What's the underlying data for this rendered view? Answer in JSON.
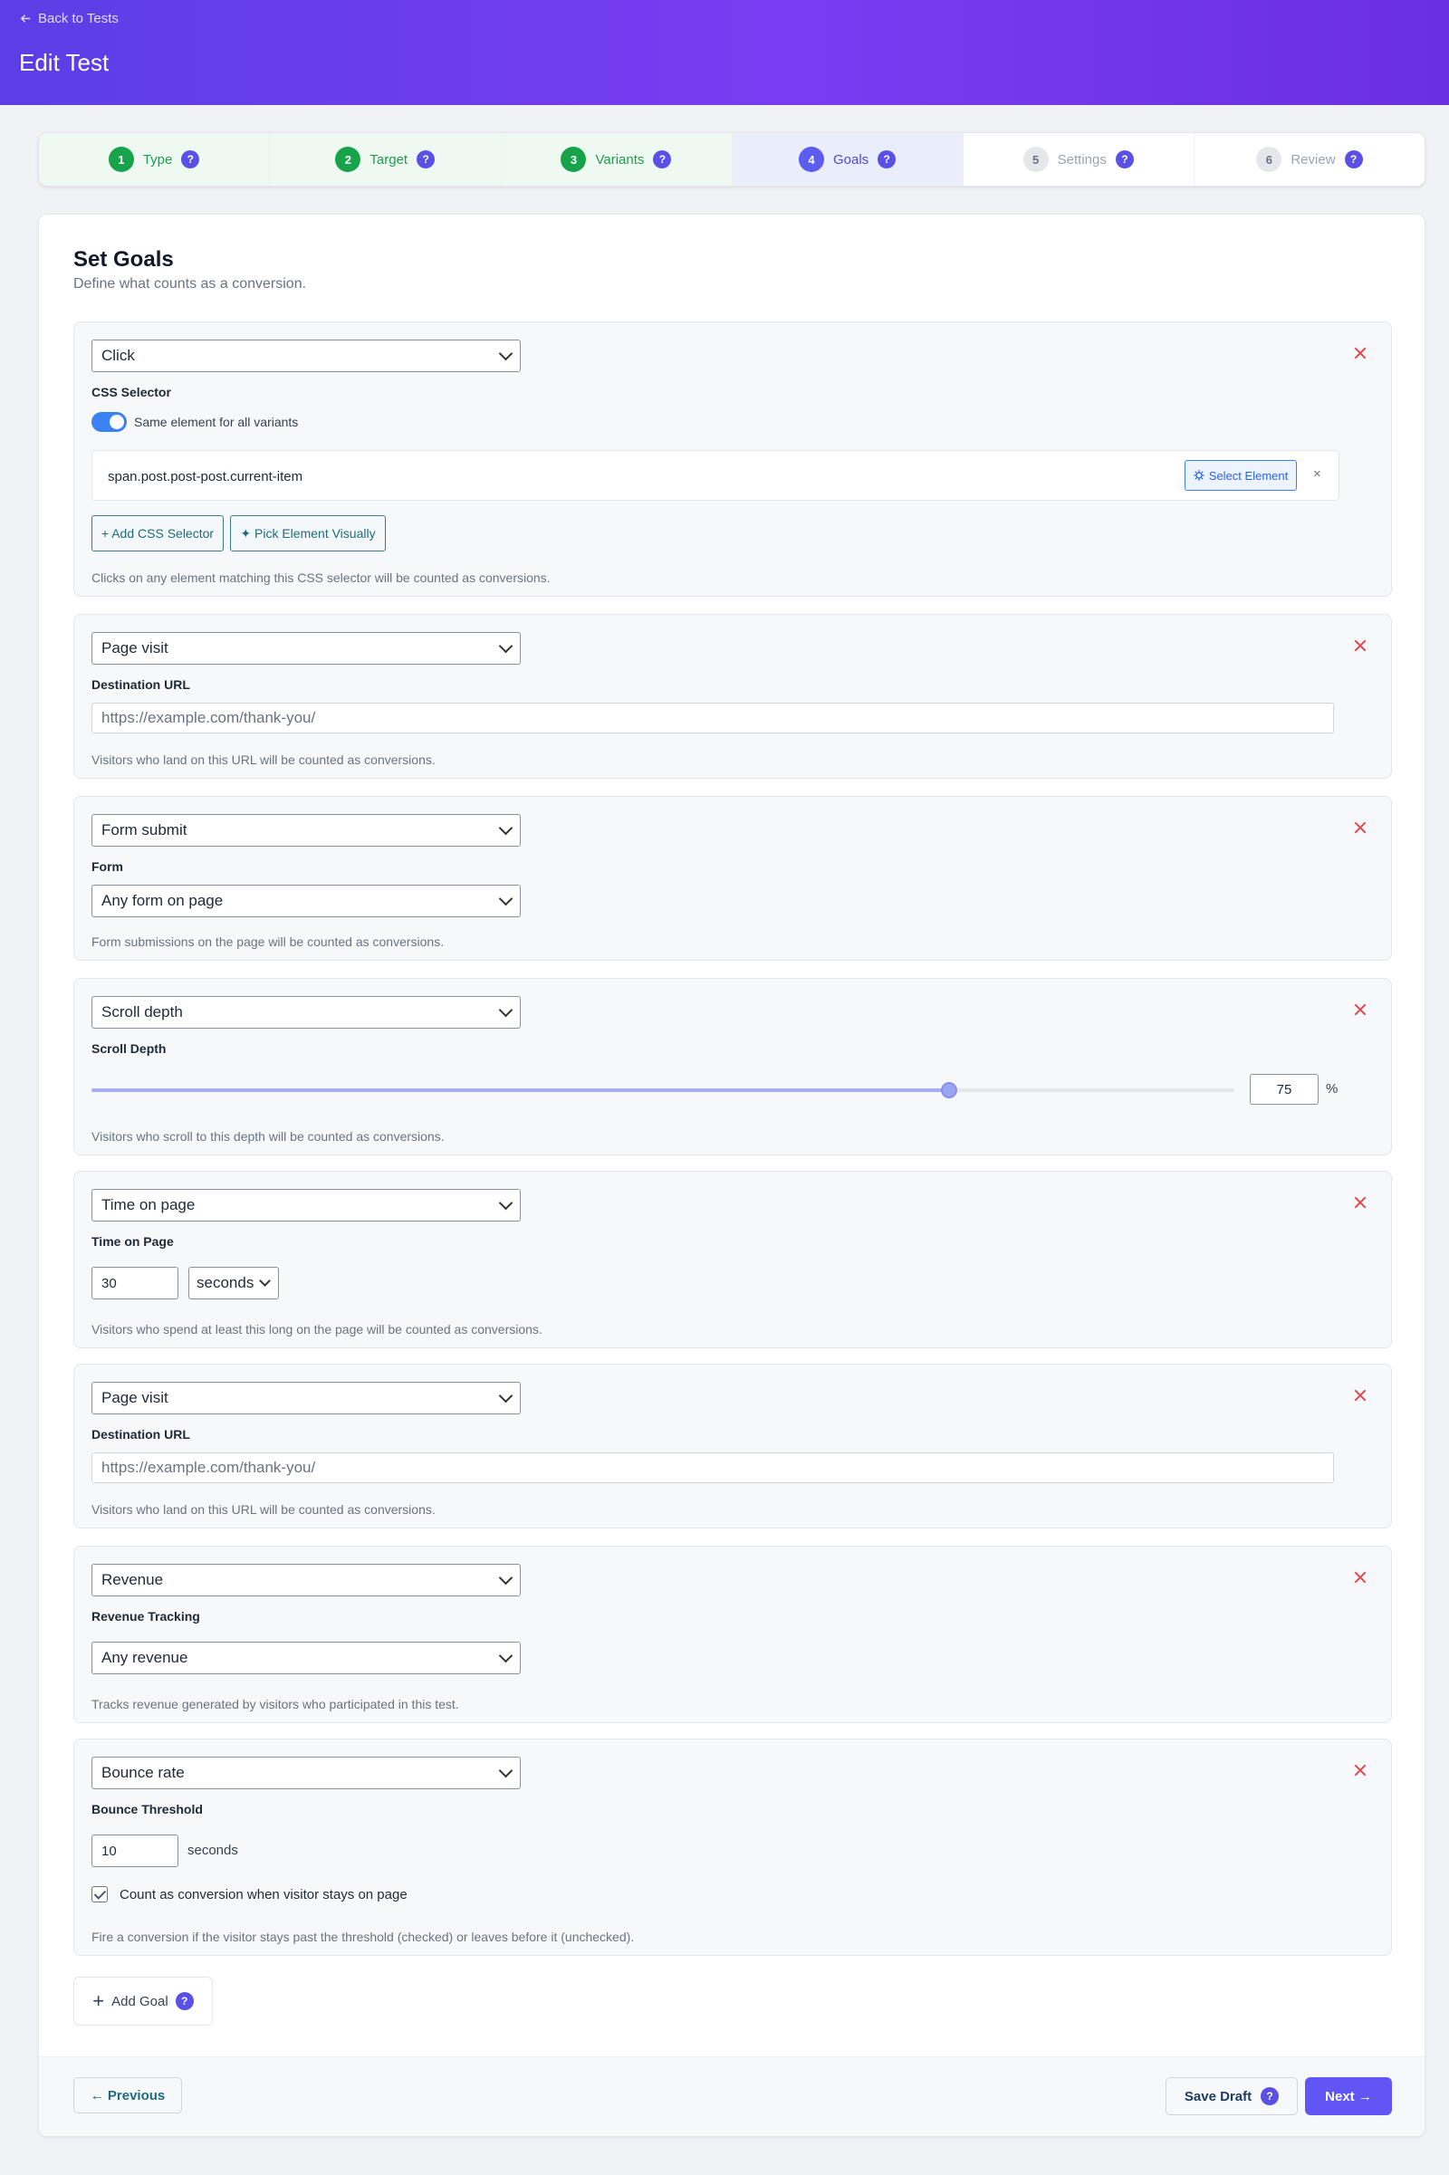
{
  "header": {
    "back_label": "Back to Tests",
    "title": "Edit Test"
  },
  "steps": [
    {
      "num": "1",
      "label": "Type",
      "state": "done"
    },
    {
      "num": "2",
      "label": "Target",
      "state": "done"
    },
    {
      "num": "3",
      "label": "Variants",
      "state": "done"
    },
    {
      "num": "4",
      "label": "Goals",
      "state": "active"
    },
    {
      "num": "5",
      "label": "Settings",
      "state": "todo"
    },
    {
      "num": "6",
      "label": "Review",
      "state": "todo"
    }
  ],
  "help_glyph": "?",
  "main": {
    "title": "Set Goals",
    "subtitle": "Define what counts as a conversion."
  },
  "goals": [
    {
      "type": "Click",
      "label": "CSS Selector",
      "toggle_label": "Same element for all variants",
      "selector_value": "span.post.post-post.current-item",
      "select_element_label": "Select Element",
      "clear_glyph": "×",
      "add_selector_label": "+ Add CSS Selector",
      "pick_visually_label": "✦ Pick Element Visually",
      "help": "Clicks on any element matching this CSS selector will be counted as conversions."
    },
    {
      "type": "Page visit",
      "label": "Destination URL",
      "placeholder": "https://example.com/thank-you/",
      "help": "Visitors who land on this URL will be counted as conversions."
    },
    {
      "type": "Form submit",
      "label": "Form",
      "form_value": "Any form on page",
      "help": "Form submissions on the page will be counted as conversions."
    },
    {
      "type": "Scroll depth",
      "label": "Scroll Depth",
      "value": 75,
      "value_text": "75",
      "unit": "%",
      "help": "Visitors who scroll to this depth will be counted as conversions."
    },
    {
      "type": "Time on page",
      "label": "Time on Page",
      "value": "30",
      "unit": "seconds",
      "help": "Visitors who spend at least this long on the page will be counted as conversions."
    },
    {
      "type": "Page visit",
      "label": "Destination URL",
      "placeholder": "https://example.com/thank-you/",
      "help": "Visitors who land on this URL will be counted as conversions."
    },
    {
      "type": "Revenue",
      "label": "Revenue Tracking",
      "revenue_value": "Any revenue",
      "help": "Tracks revenue generated by visitors who participated in this test."
    },
    {
      "type": "Bounce rate",
      "label": "Bounce Threshold",
      "value": "10",
      "unit": "seconds",
      "checkbox_label": "Count as conversion when visitor stays on page",
      "checked": true,
      "help": "Fire a conversion if the visitor stays past the threshold (checked) or leaves before it (unchecked)."
    }
  ],
  "add_goal_label": "Add Goal",
  "add_goal_glyph": "+",
  "footer": {
    "previous_label": "← Previous",
    "save_draft_label": "Save Draft",
    "next_label": "Next →"
  },
  "colors": {
    "accent": "#6155f5",
    "done": "#16a34a",
    "danger": "#e0474c",
    "header_from": "#5b3ee6",
    "header_to": "#6a2fe0"
  }
}
